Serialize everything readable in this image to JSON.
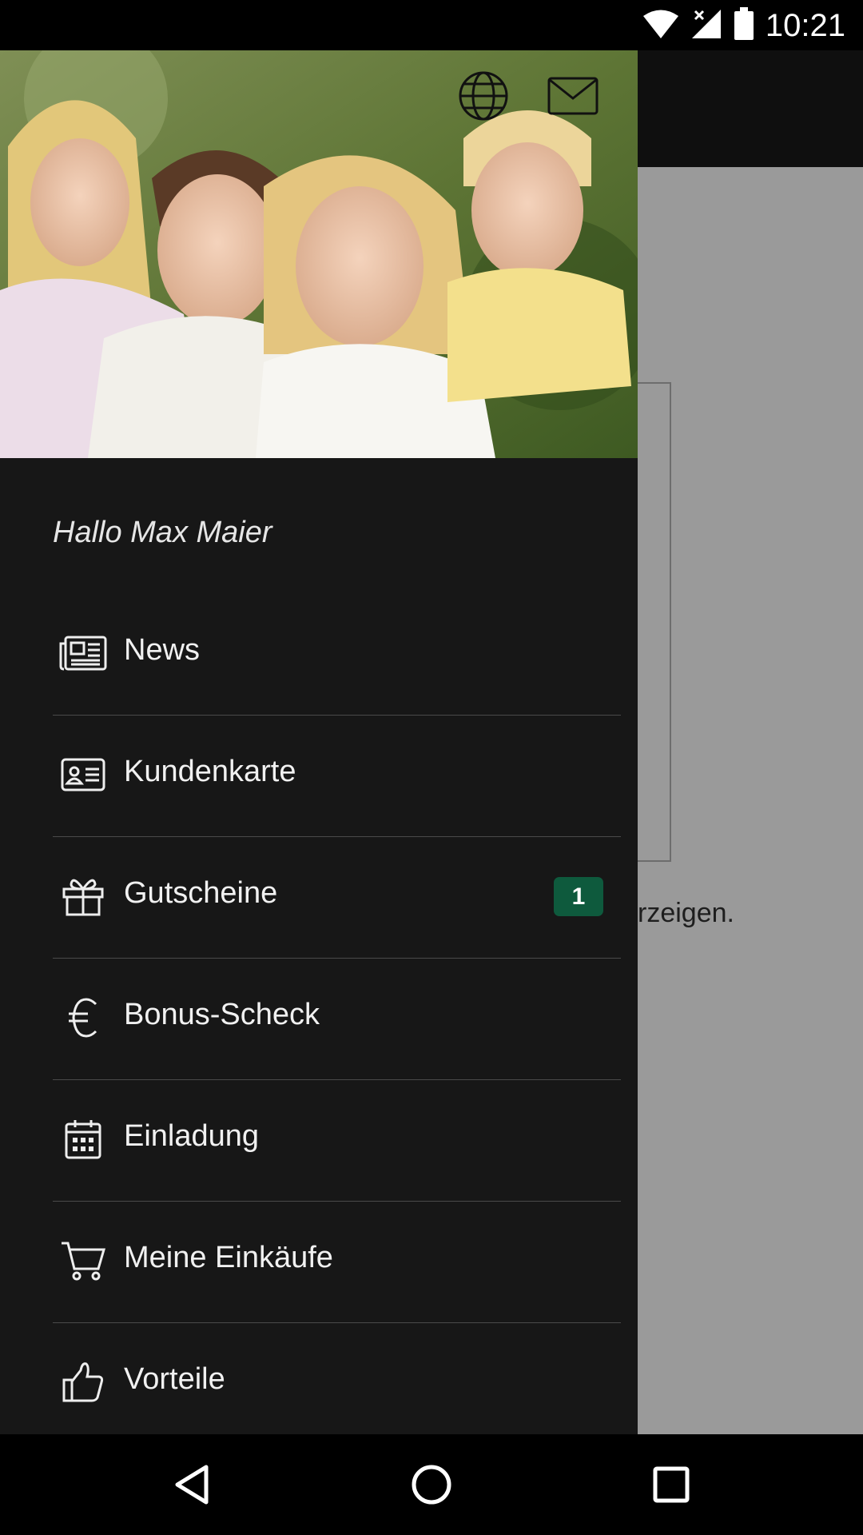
{
  "status_bar": {
    "time": "10:21"
  },
  "background_screen": {
    "hint_text": "rzeigen."
  },
  "drawer": {
    "greeting": "Hallo Max Maier",
    "items": [
      {
        "label": "News",
        "icon": "newspaper-icon"
      },
      {
        "label": "Kundenkarte",
        "icon": "id-card-icon"
      },
      {
        "label": "Gutscheine",
        "icon": "gift-icon",
        "badge": "1"
      },
      {
        "label": "Bonus-Scheck",
        "icon": "euro-icon"
      },
      {
        "label": "Einladung",
        "icon": "calendar-icon"
      },
      {
        "label": "Meine Einkäufe",
        "icon": "cart-icon"
      },
      {
        "label": "Vorteile",
        "icon": "thumbs-up-icon"
      }
    ]
  },
  "colors": {
    "drawer_bg": "#171717",
    "badge_bg": "#0e5a3d",
    "app_bg": "#9a9a9a"
  }
}
